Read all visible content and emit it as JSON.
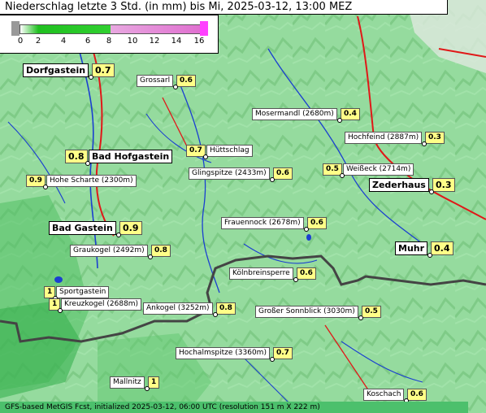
{
  "title": "Niederschlag letzte 3 Std. (in mm) bis Mi, 2025-03-12, 13:00 MEZ",
  "legend": {
    "ticks": [
      "0",
      "2",
      "4",
      "6",
      "8",
      "10",
      "12",
      "14",
      "16"
    ],
    "colors": [
      "#20c020",
      "#30d030",
      "#e070d0",
      "#ff40ff"
    ]
  },
  "places": [
    {
      "name": "Dorfgastein",
      "value": "0.7",
      "big": true
    },
    {
      "name": "Grossarl",
      "value": "0.6"
    },
    {
      "name": "Mosermandl (2680m)",
      "value": "0.4"
    },
    {
      "name": "Hochfeind (2887m)",
      "value": "0.3"
    },
    {
      "name": "Bad Hofgastein",
      "value": "0.8",
      "big": true
    },
    {
      "name": "Hüttschlag",
      "value": "0.7"
    },
    {
      "name": "Hohe Scharte (2300m)",
      "value": "0.9"
    },
    {
      "name": "Glingspitze (2433m)",
      "value": "0.6"
    },
    {
      "name": "Weißeck (2714m)",
      "value": "0.5"
    },
    {
      "name": "Zederhaus",
      "value": "0.3",
      "big": true
    },
    {
      "name": "Frauennock (2678m)",
      "value": "0.6"
    },
    {
      "name": "Bad Gastein",
      "value": "0.9",
      "big": true
    },
    {
      "name": "Graukogel (2492m)",
      "value": "0.8"
    },
    {
      "name": "Muhr",
      "value": "0.4",
      "big": true
    },
    {
      "name": "Kölnbreinsperre",
      "value": "0.6"
    },
    {
      "name": "Sportgastein",
      "value": "1"
    },
    {
      "name": "Kreuzkogel (2688m)",
      "value": "1"
    },
    {
      "name": "Ankogel (3252m)",
      "value": "0.8"
    },
    {
      "name": "Großer Sonnblick (3030m)",
      "value": "0.5"
    },
    {
      "name": "Hochalmspitze (3360m)",
      "value": "0.7"
    },
    {
      "name": "Mallnitz",
      "value": "1"
    },
    {
      "name": "Koschach",
      "value": "0.6"
    }
  ],
  "footer": "GFS-based MetGIS Fcst, initialized 2025-03-12, 06:00 UTC  (resolution 151 m X 222 m)"
}
